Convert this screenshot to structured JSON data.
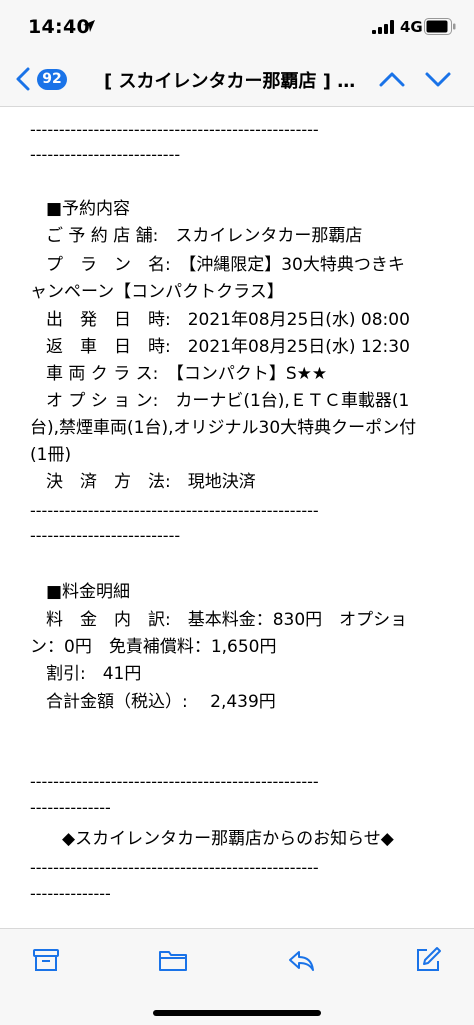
{
  "status_bar": {
    "time": "14:40",
    "network": "4G",
    "icons": [
      "location-arrow-icon",
      "signal-bars-icon",
      "battery-icon"
    ]
  },
  "nav": {
    "unread_count": "92",
    "title": "[ スカイレンタカー那覇店 ] ご…",
    "icons": [
      "chevron-left-icon",
      "chevron-up-icon",
      "chevron-down-icon"
    ]
  },
  "email": {
    "top_partial": "・・・",
    "divider_long": "--------------------------------------------------",
    "divider_short1": "--------------------------",
    "reservation_header": "■予約内容",
    "store": "ご 予 約 店 舗:　スカイレンタカー那覇店",
    "plan_line1": "プ　ラ　ン　名:　【沖縄限定】30大特典つきキ",
    "plan_line2": "ャンペーン【コンパクトクラス】",
    "departure": "出　発　日　時:　2021年08月25日(水) 08:00",
    "return": "返　車　日　時:　2021年08月25日(水) 12:30",
    "car_class": "車 両 ク ラ ス:　【コンパクト】S★★",
    "option_line1": "オ プ シ ョ ン:　カーナビ(1台),ＥＴＣ車載器(1",
    "option_line2": "台),禁煙車両(1台),オリジナル30大特典クーポン付",
    "option_line3": "(1冊)",
    "payment": "決　済　方　法:　現地決済",
    "divider_short2": "--------------------------",
    "fee_header": "■料金明細",
    "fee_line1": "料　金　内　訳:　基本料金：830円　オプショ",
    "fee_line2": "ン：0円　免責補償料：1,650円",
    "discount": "割引:　41円",
    "total": "合計金額（税込）:　 2,439円",
    "divider_short3": "--------------",
    "notice_header": "◆スカイレンタカー那覇店からのお知らせ◆",
    "divider_short4": "--------------"
  },
  "toolbar": {
    "icons": [
      "archive-icon",
      "folder-icon",
      "reply-icon",
      "compose-icon"
    ]
  },
  "colors": {
    "accent": "#1a73e8",
    "bar_bg": "#f7f7f7"
  }
}
